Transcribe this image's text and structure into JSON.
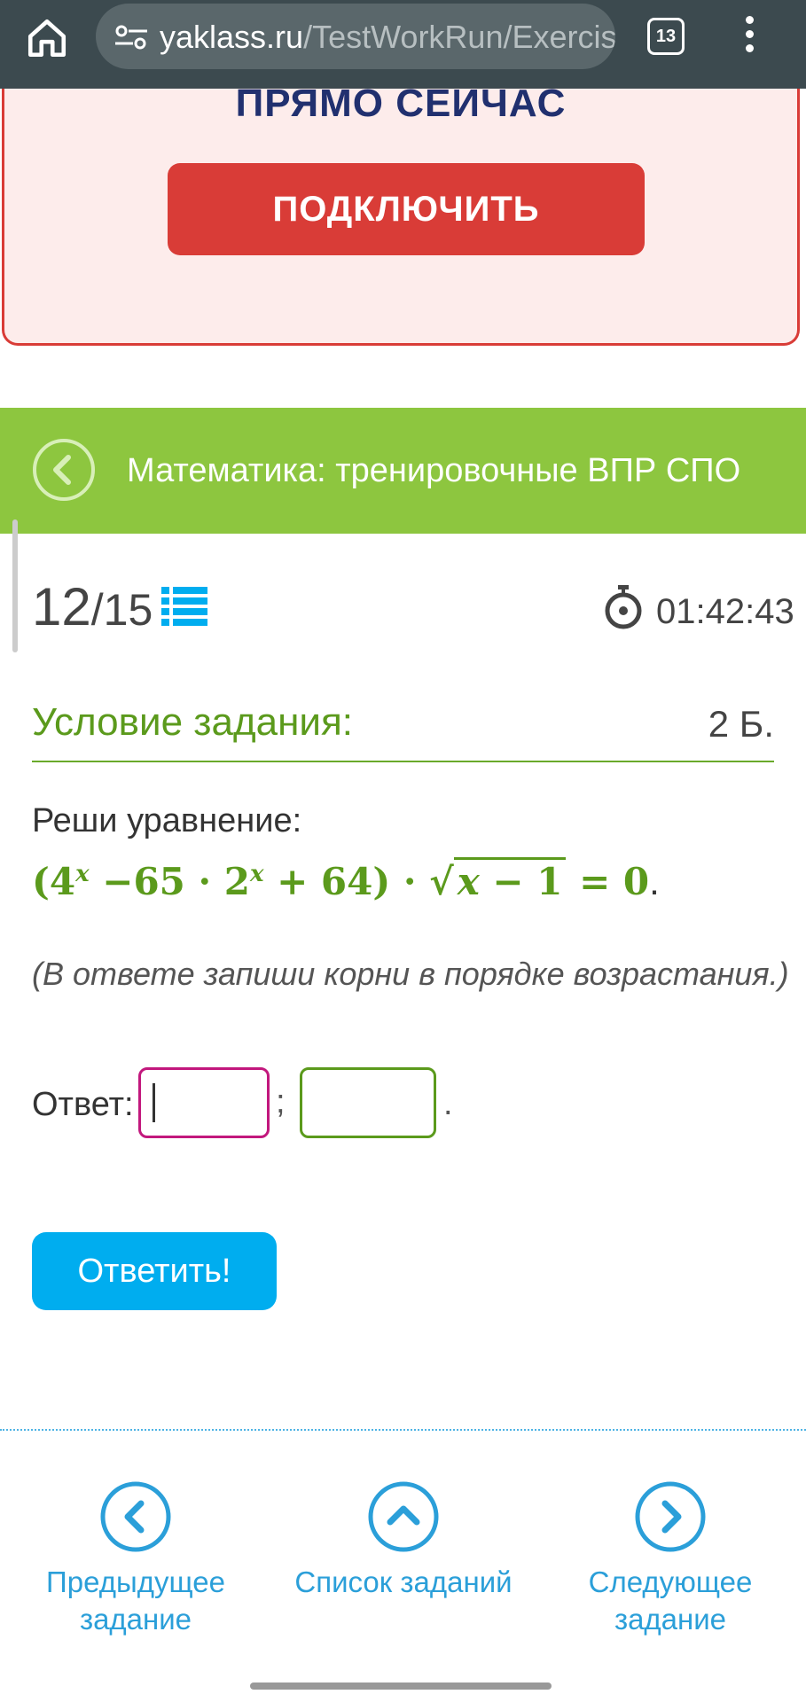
{
  "browser": {
    "url_domain": "yaklass.ru",
    "url_path": "/TestWorkRun/Exercis",
    "tab_count": "13",
    "icons": {
      "home": "home-icon",
      "site_settings": "tune-icon",
      "menu": "more-vert-icon"
    }
  },
  "promo": {
    "cut_off_text": "ПРЯМО СЕЙЧАС",
    "button_label": "ПОДКЛЮЧИТЬ"
  },
  "course": {
    "title": "Математика: тренировочные ВПР СПО"
  },
  "progress": {
    "current": "12",
    "total": "/15"
  },
  "timer": {
    "value": "01:42:43"
  },
  "task": {
    "condition_title": "Условие задания:",
    "points": "2 Б.",
    "intro": "Реши уравнение:",
    "hint": "(В ответе запиши корни в порядке возрастания.)"
  },
  "answer": {
    "label": "Ответ:",
    "separator": ";",
    "end": ".",
    "value1": "",
    "value2": ""
  },
  "submit_label": "Ответить!",
  "nav": {
    "prev_line1": "Предыдущее",
    "prev_line2": "задание",
    "list": "Список заданий",
    "next_line1": "Следующее",
    "next_line2": "задание"
  },
  "colors": {
    "brand_green": "#8dc63f",
    "accent_blue": "#00adef",
    "promo_red": "#d93c37",
    "focus_magenta": "#c2187d"
  }
}
